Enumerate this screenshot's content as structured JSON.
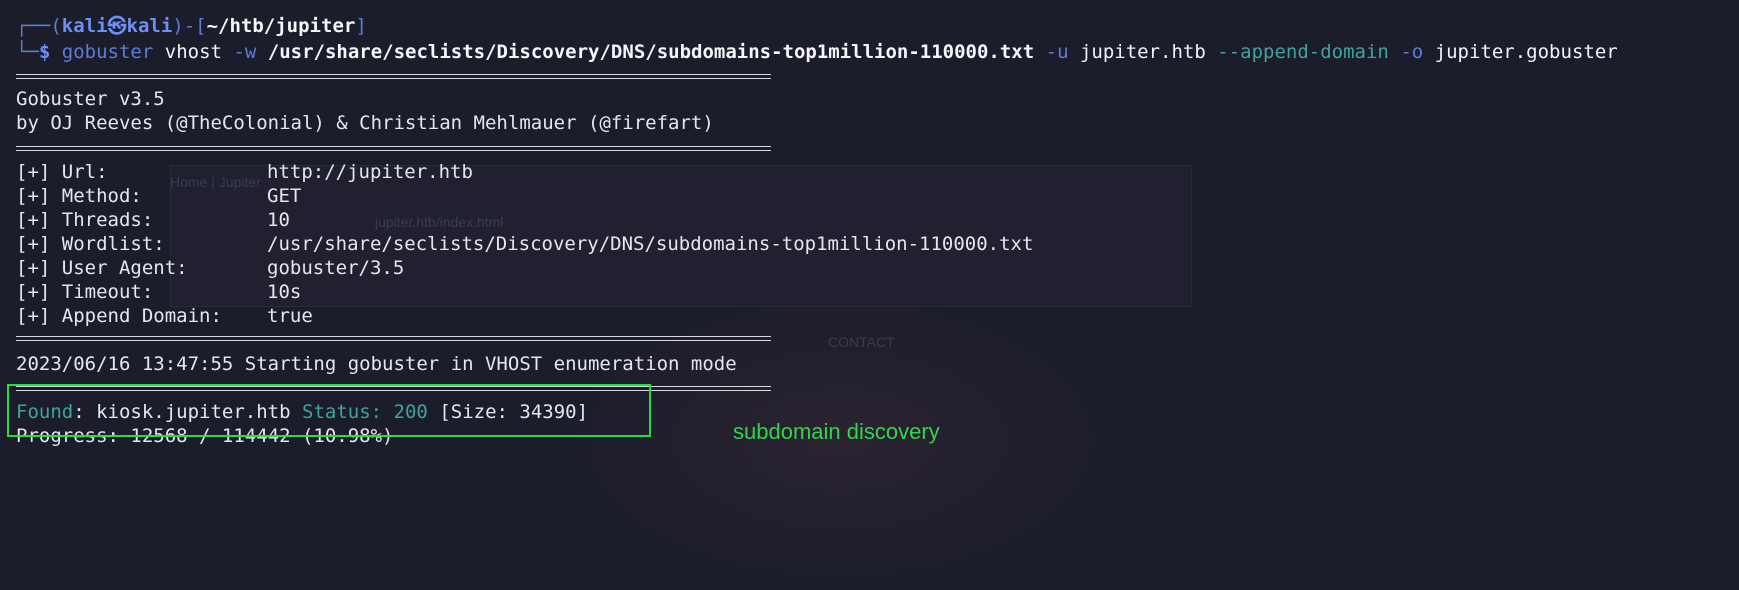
{
  "prompt": {
    "open": "┌──(",
    "user": "kali㉿kali",
    "mid": ")-[",
    "path": "~/htb/jupiter",
    "close": "]",
    "line2_prefix": "└─",
    "dollar": "$"
  },
  "command": {
    "cmd": "gobuster",
    "sub": "vhost",
    "flag_w": "-w",
    "wordlist": "/usr/share/seclists/Discovery/DNS/subdomains-top1million-110000.txt",
    "flag_u": "-u",
    "url": "jupiter.htb",
    "flag_append": "--append-domain",
    "flag_o": "-o",
    "outfile": "jupiter.gobuster"
  },
  "banner": {
    "version": "Gobuster v3.5",
    "authors": "by OJ Reeves (@TheColonial) & Christian Mehlmauer (@firefart)"
  },
  "config": [
    {
      "key": "[+] Url:",
      "value": "http://jupiter.htb"
    },
    {
      "key": "[+] Method:",
      "value": "GET"
    },
    {
      "key": "[+] Threads:",
      "value": "10"
    },
    {
      "key": "[+] Wordlist:",
      "value": "/usr/share/seclists/Discovery/DNS/subdomains-top1million-110000.txt"
    },
    {
      "key": "[+] User Agent:",
      "value": "gobuster/3.5"
    },
    {
      "key": "[+] Timeout:",
      "value": "10s"
    },
    {
      "key": "[+] Append Domain:",
      "value": "true"
    }
  ],
  "start_line": "2023/06/16 13:47:55 Starting gobuster in VHOST enumeration mode",
  "result": {
    "found_label": "Found",
    "found_colon": ": ",
    "host": "kiosk.jupiter.htb",
    "status_label": "Status:",
    "status_code": "200",
    "size": "[Size: 34390]"
  },
  "progress": "Progress: 12568 / 114442 (10.98%)",
  "annotation": "subdomain discovery",
  "ghost": {
    "tab": "Home | Jupiter",
    "address": "jupiter.htb/index.html",
    "nav": "CONTACT"
  },
  "colors": {
    "background": "#1c1d2b",
    "prompt_blue": "#5b7dd6",
    "found_teal": "#3fa3a0",
    "highlight_green": "#22e03a"
  }
}
